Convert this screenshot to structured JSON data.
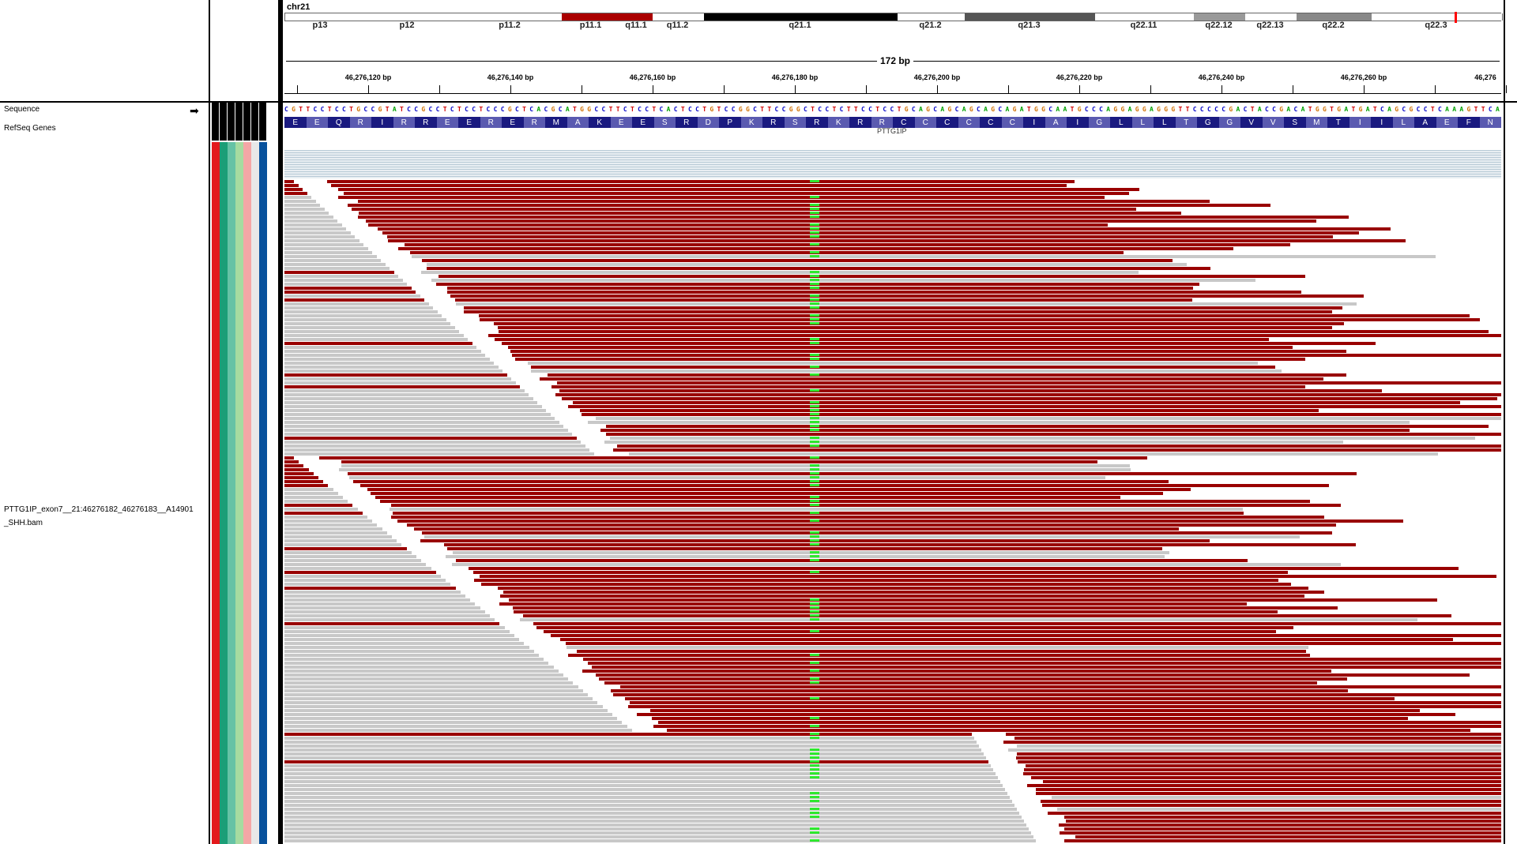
{
  "ideogram": {
    "chromosome": "chr21",
    "bands": [
      {
        "name": "p13",
        "color": "#fff"
      },
      {
        "name": "p12",
        "color": "#fff"
      },
      {
        "name": "p11.2",
        "color": "#fff"
      },
      {
        "name": "p11.1",
        "color": "#a00"
      },
      {
        "name": "q11.1",
        "color": "#a00"
      },
      {
        "name": "q11.2",
        "color": "#fff"
      },
      {
        "name": "q21.1",
        "color": "#000"
      },
      {
        "name": "q21.2",
        "color": "#fff"
      },
      {
        "name": "q21.3",
        "color": "#555"
      },
      {
        "name": "q22.11",
        "color": "#fff"
      },
      {
        "name": "q22.12",
        "color": "#999"
      },
      {
        "name": "q22.13",
        "color": "#fff"
      },
      {
        "name": "q22.2",
        "color": "#888"
      },
      {
        "name": "q22.3",
        "color": "#fff"
      }
    ]
  },
  "ruler": {
    "span": "172 bp",
    "ticks": [
      "46,276,120 bp",
      "46,276,140 bp",
      "46,276,160 bp",
      "46,276,180 bp",
      "46,276,200 bp",
      "46,276,220 bp",
      "46,276,240 bp",
      "46,276,260 bp",
      "46,276"
    ]
  },
  "tracks": {
    "sequence_name": "Sequence",
    "refseq_name": "RefSeq Genes",
    "bam_name_line1": "PTTG1IP_exon7__21:46276182_46276183__A14901",
    "bam_name_line2": "_SHH.bam",
    "gene_label": "PTTG1IP"
  },
  "sequence": "CGTTCCTCCTGCCGTATCCGCCTCTCCTCCCGCTCACGCATGGCCTTCTCCTCACTCCTGTCCGGCTTCCGGCTCCTCTTCCTCCTGCAGCAGCAGCAGCAGATGGCAATGCCCAGGAGGAGGGTTCCCCCGACTACCGACATGGTGATGATCAGCGCCTCAAAGTTCA",
  "amino_acids": [
    "E",
    "E",
    "Q",
    "R",
    "I",
    "R",
    "R",
    "E",
    "E",
    "R",
    "E",
    "R",
    "M",
    "A",
    "K",
    "E",
    "E",
    "S",
    "R",
    "D",
    "P",
    "K",
    "R",
    "S",
    "R",
    "K",
    "R",
    "R",
    "C",
    "C",
    "C",
    "C",
    "C",
    "C",
    "I",
    "A",
    "I",
    "G",
    "L",
    "L",
    "L",
    "T",
    "G",
    "G",
    "V",
    "V",
    "S",
    "M",
    "T",
    "I",
    "I",
    "L",
    "A",
    "E",
    "F",
    "N"
  ],
  "colors": {
    "forward": "#990000",
    "reverse": "#c8c8c8",
    "mismatch": "#2ee82e",
    "aa_dark": "#1a1a80",
    "aa_light": "#5a5ab0"
  },
  "attribute_colors": [
    "#e31a1c",
    "#1b9e77",
    "#66c2a5",
    "#a6dba0",
    "#f4a6a6",
    "#e8e8e8",
    "#08519c"
  ]
}
